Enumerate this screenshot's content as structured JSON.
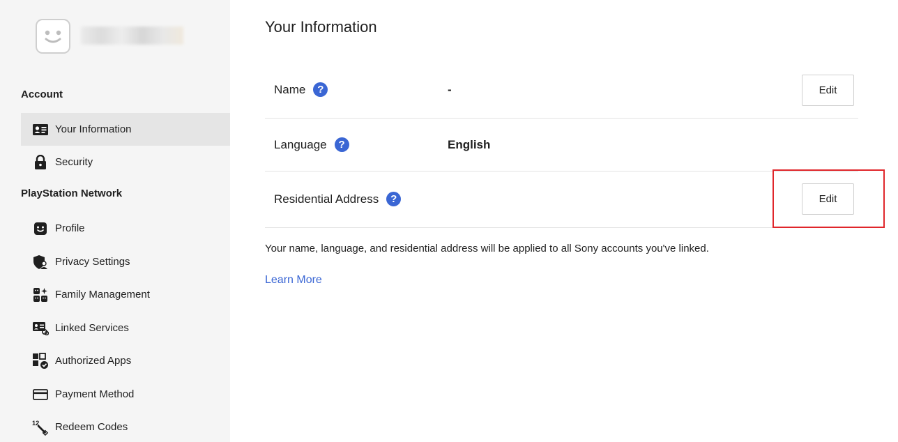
{
  "sidebar": {
    "account_section": "Account",
    "psn_section": "PlayStation Network",
    "items": [
      {
        "label": "Your Information",
        "icon": "id-card-icon"
      },
      {
        "label": "Security",
        "icon": "lock-icon"
      },
      {
        "label": "Profile",
        "icon": "face-icon"
      },
      {
        "label": "Privacy Settings",
        "icon": "shield-user-icon"
      },
      {
        "label": "Family Management",
        "icon": "family-icon"
      },
      {
        "label": "Linked Services",
        "icon": "linked-card-icon"
      },
      {
        "label": "Authorized Apps",
        "icon": "apps-check-icon"
      },
      {
        "label": "Payment Method",
        "icon": "credit-card-icon"
      },
      {
        "label": "Redeem Codes",
        "icon": "redeem-icon"
      }
    ]
  },
  "main": {
    "title": "Your Information",
    "rows": [
      {
        "label": "Name",
        "value": "-",
        "edit_label": "Edit"
      },
      {
        "label": "Language",
        "value": "English"
      },
      {
        "label": "Residential Address",
        "value": "",
        "edit_label": "Edit"
      }
    ],
    "help_glyph": "?",
    "note": "Your name, language, and residential address will be applied to all Sony accounts you've linked.",
    "learn_more": "Learn More"
  },
  "colors": {
    "accent": "#3a66d4",
    "highlight": "#e0262b",
    "sidebar_bg": "#f5f5f5",
    "active_bg": "#e5e5e5"
  }
}
